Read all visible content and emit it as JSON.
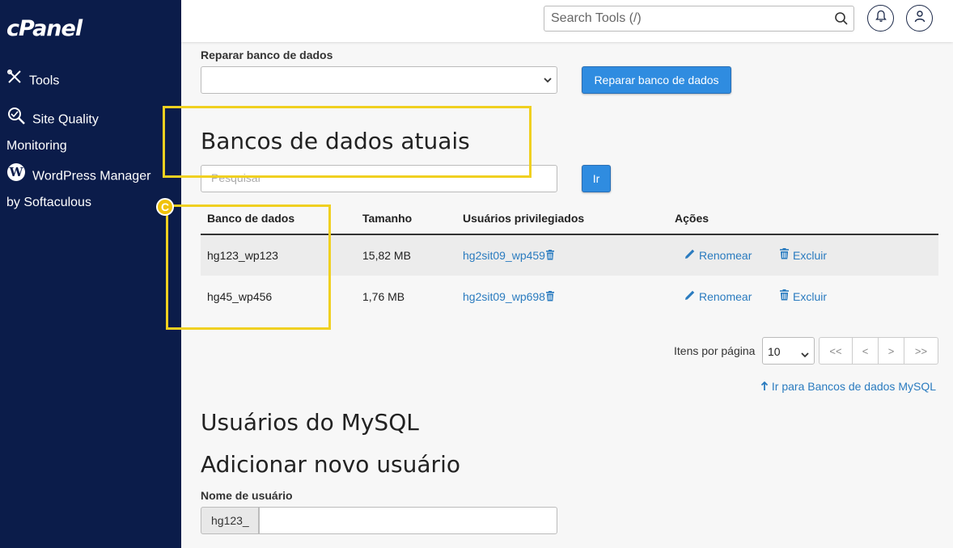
{
  "sidebar": {
    "logo": "cPanel",
    "items": [
      {
        "label": "Tools",
        "icon": "tools-icon"
      },
      {
        "label": "Site Quality",
        "label2": "Monitoring",
        "icon": "magnifier-icon"
      },
      {
        "label": "WordPress Manager",
        "label2": "by Softaculous",
        "icon": "wordpress-icon"
      }
    ]
  },
  "header": {
    "search_placeholder": "Search Tools (/)"
  },
  "repair": {
    "label": "Reparar banco de dados",
    "select_value": "",
    "button": "Reparar banco de dados"
  },
  "current_dbs": {
    "title": "Bancos de dados atuais",
    "search_placeholder": "Pesquisar",
    "go_button": "Ir",
    "columns": [
      "Banco de dados",
      "Tamanho",
      "Usuários privilegiados",
      "Ações"
    ],
    "rows": [
      {
        "name": "hg123_wp123",
        "size": "15,82 MB",
        "user": "hg2sit09_wp459"
      },
      {
        "name": "hg45_wp456",
        "size": "1,76 MB",
        "user": "hg2sit09_wp698"
      }
    ],
    "rename_label": "Renomear",
    "delete_label": "Excluir"
  },
  "pagination": {
    "label": "Itens por página",
    "per_page": "10",
    "first": "<<",
    "prev": "<",
    "next": ">",
    "last": ">>"
  },
  "goto_link": "Ir para Bancos de dados MySQL",
  "mysql_users": {
    "title": "Usuários do MySQL",
    "add_title": "Adicionar novo usuário",
    "username_label": "Nome de usuário",
    "username_prefix": "hg123_",
    "username_value": ""
  },
  "annotation": {
    "badge": "C",
    "color": "#f0d020"
  }
}
